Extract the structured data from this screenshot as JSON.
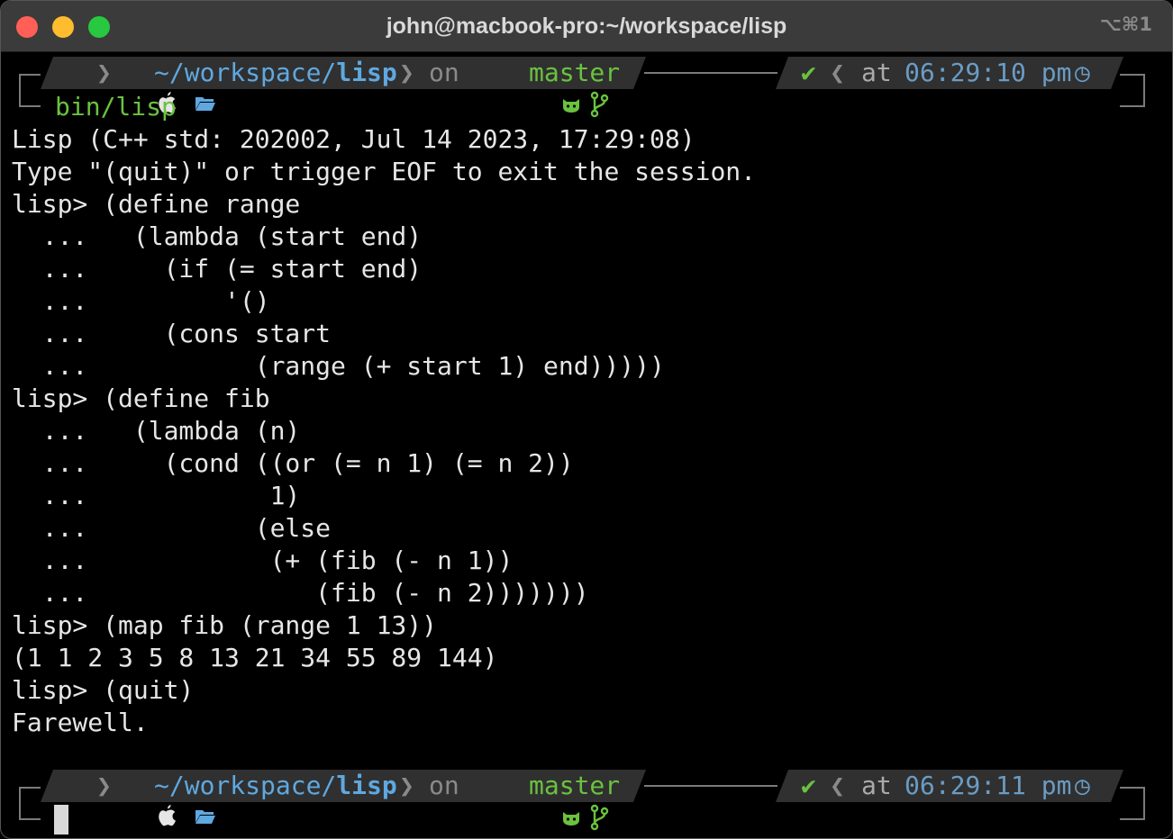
{
  "window": {
    "title": "john@macbook-pro:~/workspace/lisp",
    "shortcut": "⌥⌘1"
  },
  "prompt1": {
    "apple": "",
    "sep1": "❯",
    "folder_icon": "🗁",
    "path_prefix": "~/workspace/",
    "path_dir": "lisp",
    "sep2": "❯",
    "on": "on",
    "git_icon": "🐱",
    "branch_icon": "",
    "branch": "master",
    "status": "✔",
    "sep3": "❮",
    "at": "at",
    "time": "06:29:10 pm",
    "clock_icon": "◷"
  },
  "command": "bin/lisp",
  "output_lines": [
    "Lisp (C++ std: 202002, Jul 14 2023, 17:29:08)",
    "Type \"(quit)\" or trigger EOF to exit the session.",
    "lisp> (define range",
    "  ...   (lambda (start end)",
    "  ...     (if (= start end)",
    "  ...         '()",
    "  ...     (cons start",
    "  ...           (range (+ start 1) end)))))",
    "lisp> (define fib",
    "  ...   (lambda (n)",
    "  ...     (cond ((or (= n 1) (= n 2))",
    "  ...            1)",
    "  ...           (else",
    "  ...            (+ (fib (- n 1))",
    "  ...               (fib (- n 2)))))))",
    "lisp> (map fib (range 1 13))",
    "(1 1 2 3 5 8 13 21 34 55 89 144)",
    "lisp> (quit)",
    "Farewell."
  ],
  "prompt2": {
    "apple": "",
    "sep1": "❯",
    "folder_icon": "🗁",
    "path_prefix": "~/workspace/",
    "path_dir": "lisp",
    "sep2": "❯",
    "on": "on",
    "git_icon": "🐱",
    "branch_icon": "",
    "branch": "master",
    "status": "✔",
    "sep3": "❮",
    "at": "at",
    "time": "06:29:11 pm",
    "clock_icon": "◷"
  }
}
